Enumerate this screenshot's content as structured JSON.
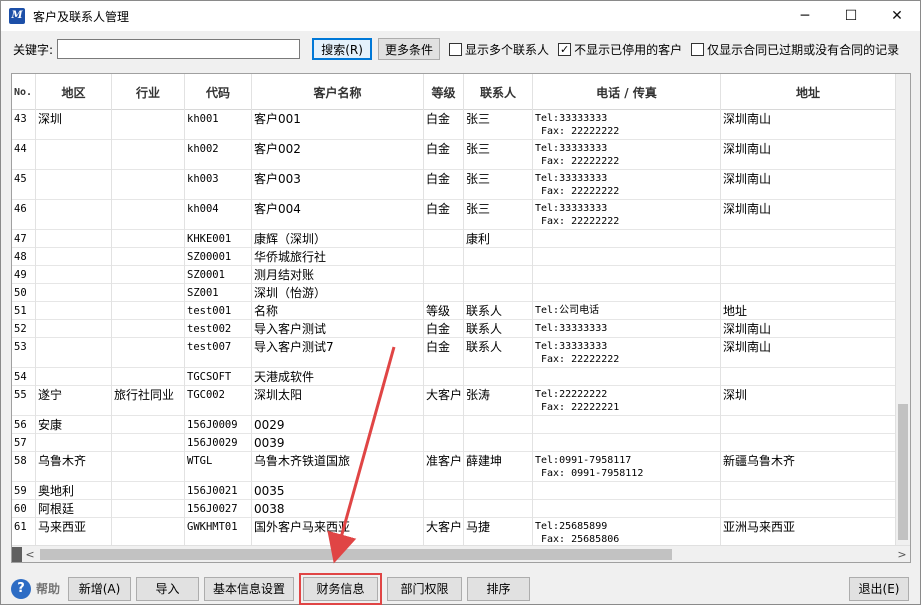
{
  "window": {
    "title": "客户及联系人管理",
    "app_icon": "app-logo-icon",
    "controls": {
      "minimize": "─",
      "maximize": "☐",
      "close": "✕"
    }
  },
  "filter": {
    "keyword_label": "关键字:",
    "keyword_value": "",
    "search_button": "搜索(R)",
    "more_button": "更多条件",
    "checkboxes": [
      {
        "label": "显示多个联系人",
        "checked": false
      },
      {
        "label": "不显示已停用的客户",
        "checked": true
      },
      {
        "label": "仅显示合同已过期或没有合同的记录",
        "checked": false
      }
    ]
  },
  "grid": {
    "columns": [
      "No.",
      "地区",
      "行业",
      "代码",
      "客户名称",
      "等级",
      "联系人",
      "电话 /   传真",
      "地址"
    ],
    "rows": [
      {
        "no": "43",
        "region": "深圳",
        "industry": "",
        "code": "kh001",
        "name": "客户001",
        "level": "白金",
        "contact": "张三",
        "tel": "Tel:33333333",
        "fax": "Fax: 22222222",
        "addr": "深圳南山"
      },
      {
        "no": "44",
        "region": "",
        "industry": "",
        "code": "kh002",
        "name": "客户002",
        "level": "白金",
        "contact": "张三",
        "tel": "Tel:33333333",
        "fax": "Fax: 22222222",
        "addr": "深圳南山"
      },
      {
        "no": "45",
        "region": "",
        "industry": "",
        "code": "kh003",
        "name": "客户003",
        "level": "白金",
        "contact": "张三",
        "tel": "Tel:33333333",
        "fax": "Fax: 22222222",
        "addr": "深圳南山"
      },
      {
        "no": "46",
        "region": "",
        "industry": "",
        "code": "kh004",
        "name": "客户004",
        "level": "白金",
        "contact": "张三",
        "tel": "Tel:33333333",
        "fax": "Fax: 22222222",
        "addr": "深圳南山"
      },
      {
        "no": "47",
        "region": "",
        "industry": "",
        "code": "KHKE001",
        "name": "康辉（深圳）",
        "level": "",
        "contact": "康利",
        "tel": "",
        "fax": "",
        "addr": ""
      },
      {
        "no": "48",
        "region": "",
        "industry": "",
        "code": "SZ00001",
        "name": "华侨城旅行社",
        "level": "",
        "contact": "",
        "tel": "",
        "fax": "",
        "addr": ""
      },
      {
        "no": "49",
        "region": "",
        "industry": "",
        "code": "SZ0001",
        "name": "测月结对账",
        "level": "",
        "contact": "",
        "tel": "",
        "fax": "",
        "addr": ""
      },
      {
        "no": "50",
        "region": "",
        "industry": "",
        "code": "SZ001",
        "name": "深圳（怡游）",
        "level": "",
        "contact": "",
        "tel": "",
        "fax": "",
        "addr": ""
      },
      {
        "no": "51",
        "region": "",
        "industry": "",
        "code": "test001",
        "name": "名称",
        "level": "等级",
        "contact": "联系人",
        "tel": "Tel:公司电话",
        "fax": "",
        "addr": "地址"
      },
      {
        "no": "52",
        "region": "",
        "industry": "",
        "code": "test002",
        "name": "导入客户测试",
        "level": "白金",
        "contact": "联系人",
        "tel": "Tel:33333333",
        "fax": "",
        "addr": "深圳南山"
      },
      {
        "no": "53",
        "region": "",
        "industry": "",
        "code": "test007",
        "name": "导入客户测试7",
        "level": "白金",
        "contact": "联系人",
        "tel": "Tel:33333333",
        "fax": "Fax: 22222222",
        "addr": "深圳南山"
      },
      {
        "no": "54",
        "region": "",
        "industry": "",
        "code": "TGCSOFT",
        "name": "天港成软件",
        "level": "",
        "contact": "",
        "tel": "",
        "fax": "",
        "addr": ""
      },
      {
        "no": "55",
        "region": "遂宁",
        "industry": "旅行社同业",
        "code": "TGC002",
        "name": "深圳太阳",
        "level": "大客户",
        "contact": "张涛",
        "tel": "Tel:22222222",
        "fax": "Fax: 22222221",
        "addr": "深圳"
      },
      {
        "no": "56",
        "region": "安康",
        "industry": "",
        "code": "156J0009",
        "name": "0029",
        "level": "",
        "contact": "",
        "tel": "",
        "fax": "",
        "addr": ""
      },
      {
        "no": "57",
        "region": "",
        "industry": "",
        "code": "156J0029",
        "name": "0039",
        "level": "",
        "contact": "",
        "tel": "",
        "fax": "",
        "addr": ""
      },
      {
        "no": "58",
        "region": "乌鲁木齐",
        "industry": "",
        "code": "WTGL",
        "name": "乌鲁木齐铁道国旅",
        "level": "准客户",
        "contact": "薛建坤",
        "tel": "Tel:0991-7958117",
        "fax": "Fax: 0991-7958112",
        "addr": "新疆乌鲁木齐"
      },
      {
        "no": "59",
        "region": "奥地利",
        "industry": "",
        "code": "156J0021",
        "name": "0035",
        "level": "",
        "contact": "",
        "tel": "",
        "fax": "",
        "addr": ""
      },
      {
        "no": "60",
        "region": "阿根廷",
        "industry": "",
        "code": "156J0027",
        "name": "0038",
        "level": "",
        "contact": "",
        "tel": "",
        "fax": "",
        "addr": ""
      },
      {
        "no": "61",
        "region": "马来西亚",
        "industry": "",
        "code": "GWKHMT01",
        "name": "国外客户马来西亚",
        "level": "大客户",
        "contact": "马捷",
        "tel": "Tel:25685899",
        "fax": "Fax: 25685806",
        "addr": "亚洲马来西亚"
      }
    ]
  },
  "scrollbar": {
    "left_arrow": "<",
    "right_arrow": ">"
  },
  "bottom": {
    "help_label": "帮助",
    "help_icon": "help-question-icon",
    "add": "新增(A)",
    "import": "导入",
    "basic_info": "基本信息设置",
    "finance": "财务信息",
    "dept": "部门权限",
    "sort": "排序",
    "exit": "退出(E)"
  },
  "annotation": {
    "color": "#e04545"
  }
}
